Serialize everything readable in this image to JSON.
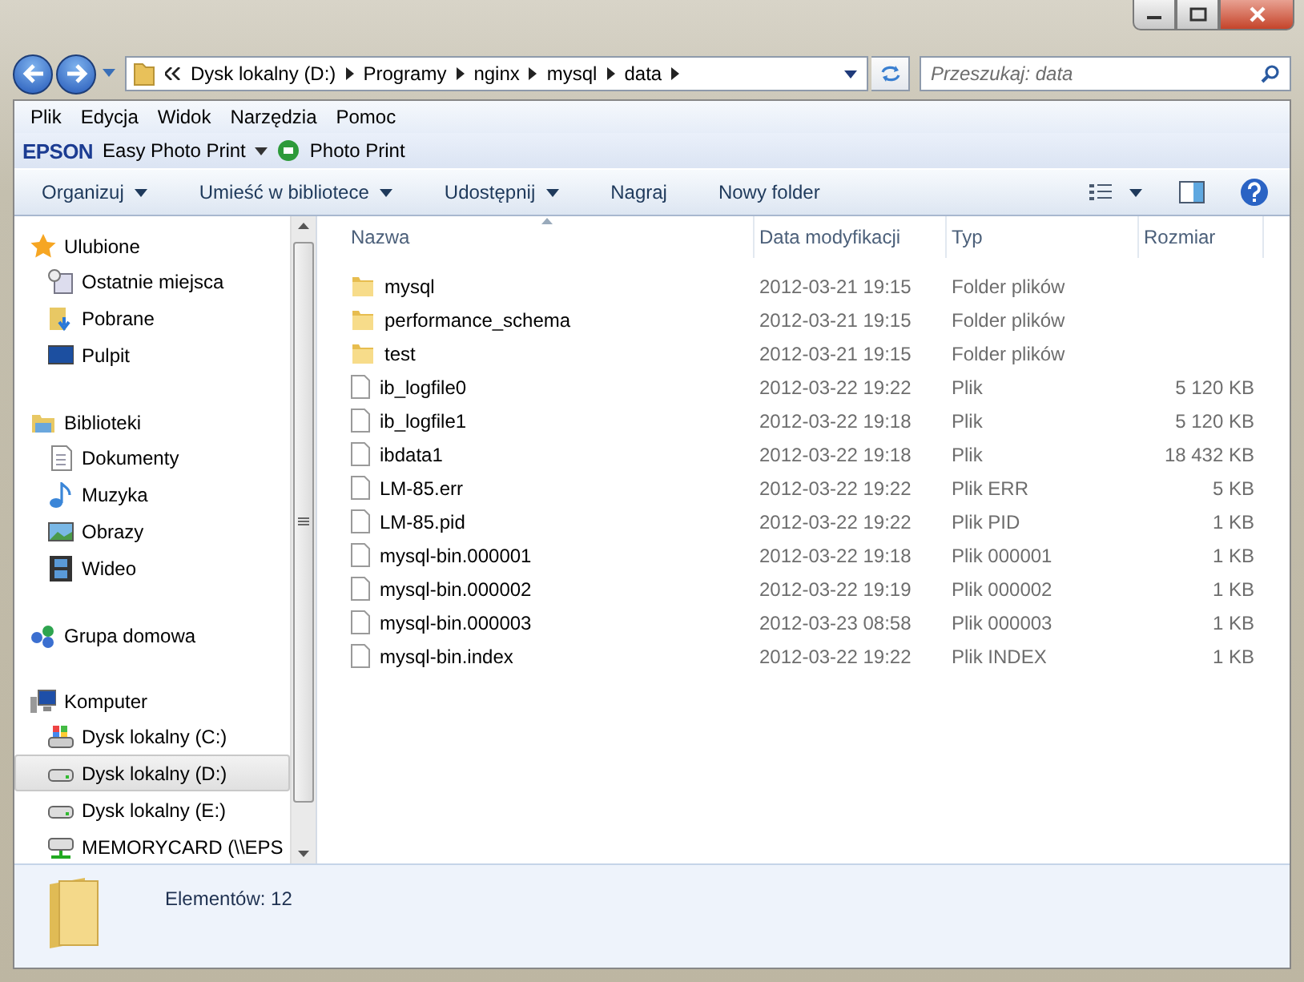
{
  "address": {
    "segments": [
      "Dysk lokalny (D:)",
      "Programy",
      "nginx",
      "mysql",
      "data"
    ]
  },
  "search": {
    "placeholder": "Przeszukaj: data"
  },
  "menu": [
    "Plik",
    "Edycja",
    "Widok",
    "Narzędzia",
    "Pomoc"
  ],
  "epson_bar": {
    "brand": "EPSON",
    "items": [
      "Easy Photo Print",
      "Photo Print"
    ]
  },
  "toolbar": [
    {
      "label": "Organizuj",
      "dropdown": true
    },
    {
      "label": "Umieść w bibliotece",
      "dropdown": true
    },
    {
      "label": "Udostępnij",
      "dropdown": true
    },
    {
      "label": "Nagraj",
      "dropdown": false
    },
    {
      "label": "Nowy folder",
      "dropdown": false
    }
  ],
  "sidebar": {
    "groups": [
      {
        "label": "Ulubione",
        "items": [
          {
            "label": "Ostatnie miejsca",
            "selected": false
          },
          {
            "label": "Pobrane",
            "selected": false
          },
          {
            "label": "Pulpit",
            "selected": false
          }
        ]
      },
      {
        "label": "Biblioteki",
        "items": [
          {
            "label": "Dokumenty",
            "selected": false
          },
          {
            "label": "Muzyka",
            "selected": false
          },
          {
            "label": "Obrazy",
            "selected": false
          },
          {
            "label": "Wideo",
            "selected": false
          }
        ]
      },
      {
        "label": "Grupa domowa"
      },
      {
        "label": "Komputer",
        "items": [
          {
            "label": "Dysk lokalny (C:)",
            "selected": false
          },
          {
            "label": "Dysk lokalny (D:)",
            "selected": true
          },
          {
            "label": "Dysk lokalny (E:)",
            "selected": false
          },
          {
            "label": "MEMORYCARD (\\\\EPS",
            "selected": false
          }
        ]
      }
    ]
  },
  "table": {
    "columns": [
      "Nazwa",
      "Data modyfikacji",
      "Typ",
      "Rozmiar"
    ],
    "rows": [
      {
        "kind": "folder",
        "name": "mysql",
        "date": "2012-03-21 19:15",
        "type": "Folder plików",
        "size": ""
      },
      {
        "kind": "folder",
        "name": "performance_schema",
        "date": "2012-03-21 19:15",
        "type": "Folder plików",
        "size": ""
      },
      {
        "kind": "folder",
        "name": "test",
        "date": "2012-03-21 19:15",
        "type": "Folder plików",
        "size": ""
      },
      {
        "kind": "file",
        "name": "ib_logfile0",
        "date": "2012-03-22 19:22",
        "type": "Plik",
        "size": "5 120 KB"
      },
      {
        "kind": "file",
        "name": "ib_logfile1",
        "date": "2012-03-22 19:18",
        "type": "Plik",
        "size": "5 120 KB"
      },
      {
        "kind": "file",
        "name": "ibdata1",
        "date": "2012-03-22 19:18",
        "type": "Plik",
        "size": "18 432 KB"
      },
      {
        "kind": "file",
        "name": "LM-85.err",
        "date": "2012-03-22 19:22",
        "type": "Plik ERR",
        "size": "5 KB"
      },
      {
        "kind": "file",
        "name": "LM-85.pid",
        "date": "2012-03-22 19:22",
        "type": "Plik PID",
        "size": "1 KB"
      },
      {
        "kind": "file",
        "name": "mysql-bin.000001",
        "date": "2012-03-22 19:18",
        "type": "Plik 000001",
        "size": "1 KB"
      },
      {
        "kind": "file",
        "name": "mysql-bin.000002",
        "date": "2012-03-22 19:19",
        "type": "Plik 000002",
        "size": "1 KB"
      },
      {
        "kind": "file",
        "name": "mysql-bin.000003",
        "date": "2012-03-23 08:58",
        "type": "Plik 000003",
        "size": "1 KB"
      },
      {
        "kind": "file",
        "name": "mysql-bin.index",
        "date": "2012-03-22 19:22",
        "type": "Plik INDEX",
        "size": "1 KB"
      }
    ]
  },
  "status_bar": {
    "text": "Elementów: 12"
  }
}
